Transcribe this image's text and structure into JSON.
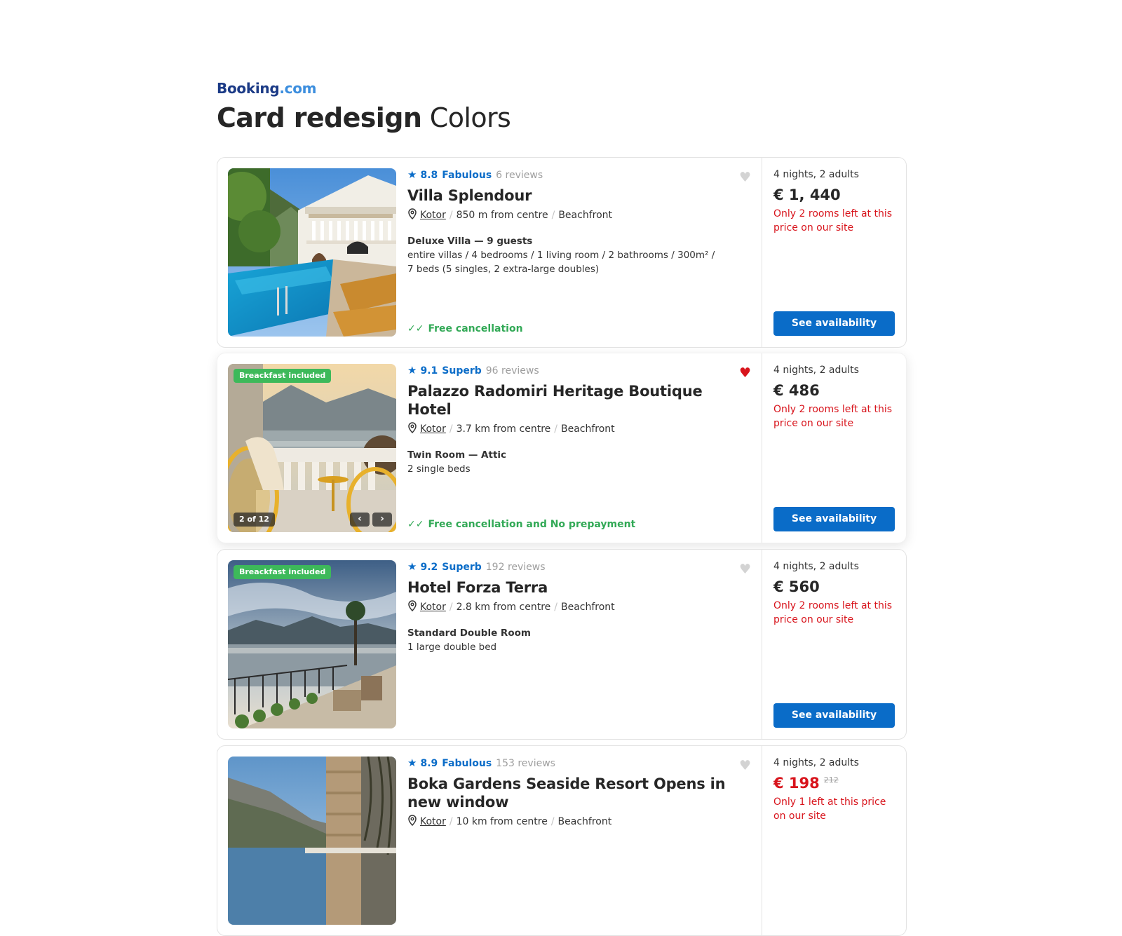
{
  "header": {
    "brand_main": "Booking",
    "brand_dot": ".com",
    "title_bold": "Card redesign",
    "title_light": "Colors"
  },
  "colors": {
    "brand_blue": "#0a6cc8",
    "green": "#32a956",
    "red": "#d8141c"
  },
  "cards": [
    {
      "score": "8.8",
      "rating_word": "Fabulous",
      "reviews": "6 reviews",
      "favorite": false,
      "name": "Villa Splendour",
      "city": "Kotor",
      "distance": "850 m from centre",
      "tag": "Beachfront",
      "room_title": "Deluxe Villa — 9 guests",
      "room_line1": "entire villas  / 4 bedrooms / 1 living room / 2 bathrooms / 300m² /",
      "room_line2": "7 beds (5 singles, 2 extra-large doubles)",
      "cancellation": "Free cancellation",
      "stay": "4 nights, 2 adults",
      "price": "€ 1, 440",
      "availability": "Only 2 rooms left at this price on our site",
      "button": "See availability"
    },
    {
      "badge": "Breackfast included",
      "photo_counter": "2 of 12",
      "score": "9.1",
      "rating_word": "Superb",
      "reviews": "96 reviews",
      "favorite": true,
      "name": "Palazzo Radomiri Heritage Boutique Hotel",
      "city": "Kotor",
      "distance": "3.7 km from centre",
      "tag": "Beachfront",
      "room_title": "Twin Room — Attic",
      "room_line1": "2 single beds",
      "cancellation": "Free cancellation and No prepayment",
      "stay": "4 nights, 2 adults",
      "price": "€ 486",
      "availability": "Only 2 rooms left at this price on our site",
      "button": "See availability"
    },
    {
      "badge": "Breackfast included",
      "score": "9.2",
      "rating_word": "Superb",
      "reviews": "192 reviews",
      "favorite": false,
      "name": "Hotel Forza Terra",
      "city": "Kotor",
      "distance": "2.8 km from centre",
      "tag": "Beachfront",
      "room_title": "Standard Double Room",
      "room_line1": "1 large double bed",
      "stay": "4 nights, 2 adults",
      "price": "€ 560",
      "availability": "Only 2 rooms left at this price on our site",
      "button": "See availability"
    },
    {
      "score": "8.9",
      "rating_word": "Fabulous",
      "reviews": "153 reviews",
      "favorite": false,
      "name": "Boka Gardens Seaside Resort Opens in new window",
      "city": "Kotor",
      "distance": "10 km from centre",
      "tag": "Beachfront",
      "stay": "4 nights, 2 adults",
      "price": "€ 198",
      "old_price": "212",
      "availability": "Only 1 left at this price on our site"
    }
  ]
}
